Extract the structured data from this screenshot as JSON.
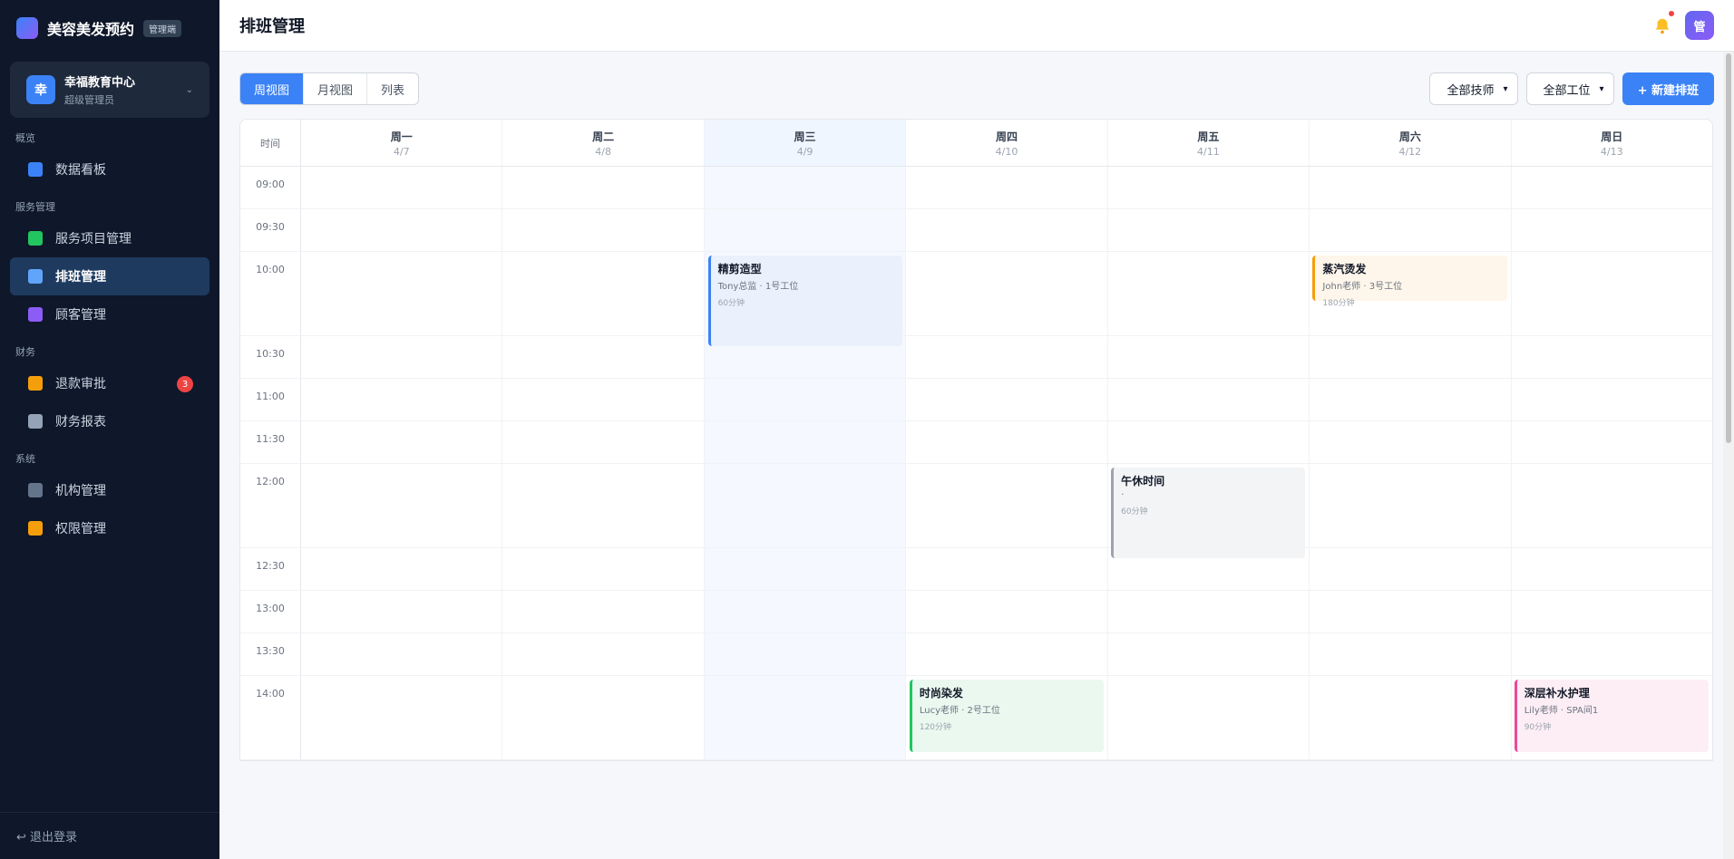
{
  "sidebar": {
    "brand_title": "美容美发预约",
    "brand_badge": "管理端",
    "org": {
      "avatar": "幸",
      "name": "幸福教育中心",
      "role": "超级管理员",
      "chevron": "⌄"
    },
    "sections": [
      {
        "label": "概览",
        "items": [
          {
            "label": "数据看板",
            "icon": "chart-icon",
            "color": "#3b82f6"
          }
        ]
      },
      {
        "label": "服务管理",
        "items": [
          {
            "label": "服务项目管理",
            "icon": "books-icon",
            "color": "#22c55e"
          },
          {
            "label": "排班管理",
            "icon": "calendar-icon",
            "color": "#60a5fa",
            "active": true
          },
          {
            "label": "顾客管理",
            "icon": "users-icon",
            "color": "#8b5cf6"
          }
        ]
      },
      {
        "label": "财务",
        "items": [
          {
            "label": "退款审批",
            "icon": "money-bag-icon",
            "color": "#f59e0b",
            "badge": "3"
          },
          {
            "label": "财务报表",
            "icon": "trend-chart-icon",
            "color": "#94a3b8"
          }
        ]
      },
      {
        "label": "系统",
        "items": [
          {
            "label": "机构管理",
            "icon": "building-icon",
            "color": "#64748b"
          },
          {
            "label": "权限管理",
            "icon": "lock-icon",
            "color": "#f59e0b"
          }
        ]
      }
    ],
    "logout": "↩ 退出登录"
  },
  "topbar": {
    "title": "排班管理",
    "avatar": "管"
  },
  "toolbar": {
    "tabs": [
      "周视图",
      "月视图",
      "列表"
    ],
    "active_tab": "周视图",
    "tech_filter": "全部技师",
    "station_filter": "全部工位",
    "new_button": "+ 新建排班"
  },
  "calendar": {
    "time_header": "时间",
    "days": [
      {
        "name": "周一",
        "date": "4/7"
      },
      {
        "name": "周二",
        "date": "4/8"
      },
      {
        "name": "周三",
        "date": "4/9",
        "today": true
      },
      {
        "name": "周四",
        "date": "4/10"
      },
      {
        "name": "周五",
        "date": "4/11"
      },
      {
        "name": "周六",
        "date": "4/12"
      },
      {
        "name": "周日",
        "date": "4/13"
      }
    ],
    "times": [
      "09:00",
      "09:30",
      "10:00",
      "10:30",
      "11:00",
      "11:30",
      "12:00",
      "12:30",
      "13:00",
      "13:30",
      "14:00"
    ],
    "events": [
      {
        "day": 2,
        "start": "10:00",
        "title": "精剪造型",
        "sub": "Tony总监 · 1号工位",
        "duration": "60分钟",
        "bg": "#eaf1fd",
        "border": "#3b82f6"
      },
      {
        "day": 5,
        "start": "10:00",
        "title": "蒸汽烫发",
        "sub": "John老师 · 3号工位",
        "duration": "180分钟",
        "bg": "#fef6ea",
        "border": "#f59e0b"
      },
      {
        "day": 4,
        "start": "12:00",
        "title": "午休时间",
        "sub": "·",
        "duration": "60分钟",
        "bg": "#f3f4f6",
        "border": "#9ca3af"
      },
      {
        "day": 3,
        "start": "14:00",
        "title": "时尚染发",
        "sub": "Lucy老师 · 2号工位",
        "duration": "120分钟",
        "bg": "#eaf8f0",
        "border": "#22c55e"
      },
      {
        "day": 6,
        "start": "14:00",
        "title": "深层补水护理",
        "sub": "Lily老师 · SPA间1",
        "duration": "90分钟",
        "bg": "#fdeef5",
        "border": "#ec4899"
      }
    ]
  }
}
